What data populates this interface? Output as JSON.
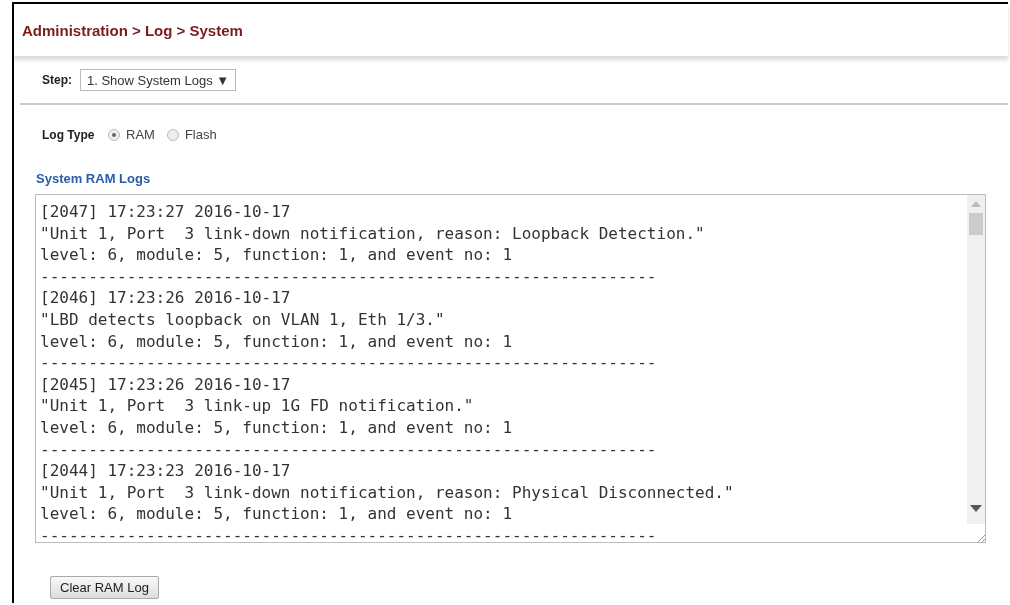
{
  "breadcrumb": "Administration > Log > System",
  "step": {
    "label": "Step:",
    "value": "1. Show System Logs ▼"
  },
  "log_type": {
    "label": "Log Type",
    "options": [
      {
        "label": "RAM",
        "selected": true
      },
      {
        "label": "Flash",
        "selected": false
      }
    ]
  },
  "section_title": "System RAM Logs",
  "logs": [
    {
      "header": "[2047] 17:23:27 2016-10-17",
      "message": "\"Unit 1, Port  3 link-down notification, reason: Loopback Detection.\"",
      "details": "level: 6, module: 5, function: 1, and event no: 1",
      "separator": "----------------------------------------------------------------"
    },
    {
      "header": "[2046] 17:23:26 2016-10-17",
      "message": "\"LBD detects loopback on VLAN 1, Eth 1/3.\"",
      "details": "level: 6, module: 5, function: 1, and event no: 1",
      "separator": "----------------------------------------------------------------"
    },
    {
      "header": "[2045] 17:23:26 2016-10-17",
      "message": "\"Unit 1, Port  3 link-up 1G FD notification.\"",
      "details": "level: 6, module: 5, function: 1, and event no: 1",
      "separator": "----------------------------------------------------------------"
    },
    {
      "header": "[2044] 17:23:23 2016-10-17",
      "message": "\"Unit 1, Port  3 link-down notification, reason: Physical Disconnected.\"",
      "details": "level: 6, module: 5, function: 1, and event no: 1",
      "separator": "----------------------------------------------------------------"
    }
  ],
  "clear_button": "Clear RAM Log"
}
